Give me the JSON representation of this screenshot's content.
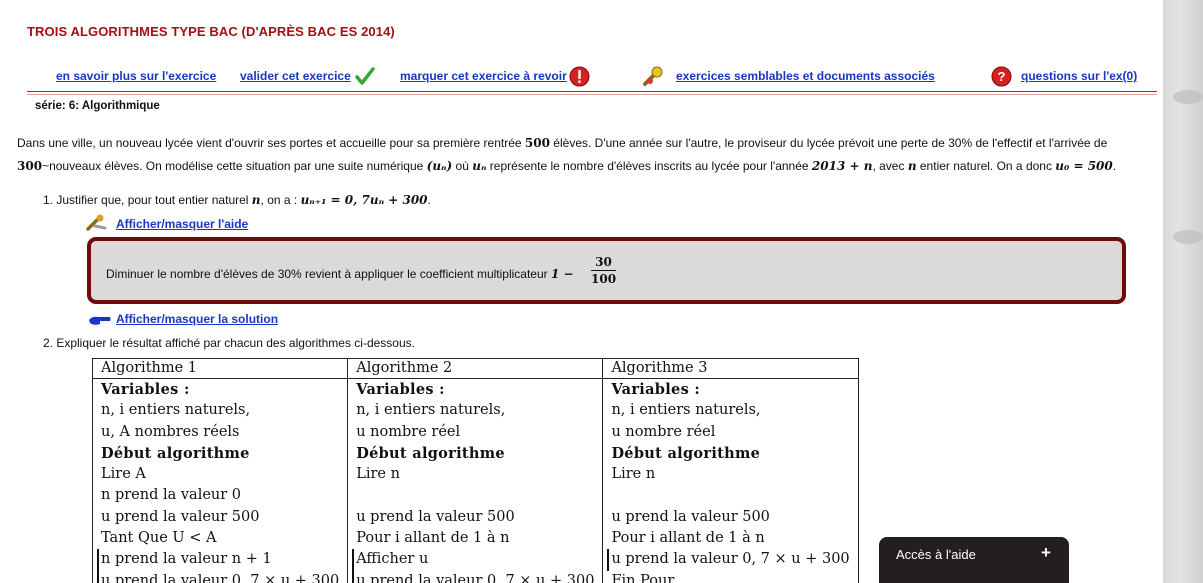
{
  "page": {
    "title": "TROIS ALGORITHMES TYPE BAC (D'APRÈS BAC ES 2014)",
    "serie": "série: 6: Algorithmique"
  },
  "toolbar": {
    "more_info": "en savoir plus sur l'exercice",
    "validate": "valider cet exercice",
    "mark_review": "marquer cet exercice à revoir",
    "similar": "exercices semblables et documents associés",
    "questions": "questions sur l'ex(0)"
  },
  "intro": {
    "line1_a": "Dans une ville, un nouveau lycée vient d'ouvrir ses portes et accueille pour sa première rentrée ",
    "line1_n": "500",
    "line1_b": " élèves. D'une année sur l'autre, le proviseur du lycée prévoit une perte de 30% de l'effectif et l'arrivée de",
    "line2_n": "300",
    "line2_a": "~nouveaux élèves. On modélise cette situation par une suite numérique ",
    "line2_un": "(uₙ)",
    "line2_b": " où ",
    "line2_un2": "uₙ",
    "line2_c": " représente le nombre d'élèves inscrits au lycée pour l'année ",
    "line2_year": "2013 + n",
    "line2_d": ", avec ",
    "line2_nv": "n",
    "line2_e": " entier naturel. On a donc ",
    "line2_eq": "u₀ = 500",
    "line2_f": "."
  },
  "q1": {
    "text": "1. Justifier que, pour tout entier naturel ",
    "n": "n",
    "mid": ", on a : ",
    "formula": "uₙ₊₁ = 0, 7uₙ + 300",
    "end": "."
  },
  "aide": {
    "toggle": "Afficher/masquer l'aide",
    "text": "Diminuer le nombre d'élèves de 30% revient à appliquer le coefficient multiplicateur ",
    "one_minus": "1 −",
    "num": "30",
    "den": "100"
  },
  "solution": {
    "toggle": "Afficher/masquer la solution"
  },
  "q2": {
    "text": "2. Expliquer le résultat affiché par chacun des algorithmes ci-dessous."
  },
  "algos": {
    "headers": [
      "Algorithme 1",
      "Algorithme 2",
      "Algorithme 3"
    ],
    "col1": [
      "Variables :",
      "n, i entiers naturels,",
      "u, A nombres réels",
      "Début algorithme",
      "Lire A",
      "n prend la valeur 0",
      "u prend la valeur 500",
      "Tant Que U < A",
      "n prend la valeur n + 1",
      "u prend la valeur 0, 7 × u + 300"
    ],
    "col2": [
      "Variables :",
      "n, i entiers naturels,",
      "u nombre réel",
      "Début algorithme",
      "Lire n",
      "",
      "u prend la valeur 500",
      "Pour i allant de 1 à n",
      "Afficher u",
      "u prend la valeur 0, 7 × u + 300"
    ],
    "col3": [
      "Variables :",
      "n, i entiers naturels,",
      "u nombre réel",
      "Début algorithme",
      "Lire n",
      "",
      "u prend la valeur 500",
      "Pour i allant de 1 à n",
      "u prend la valeur 0, 7 × u + 300",
      "Fin Pour"
    ]
  },
  "help_panel": {
    "label": "Accès à l'aide",
    "plus": "+"
  },
  "colors": {
    "title": "#a50f12",
    "link": "#1a36c4",
    "box_border": "#6e0b0d",
    "box_bg": "#dcdad9",
    "panel_bg": "#231f1e"
  }
}
